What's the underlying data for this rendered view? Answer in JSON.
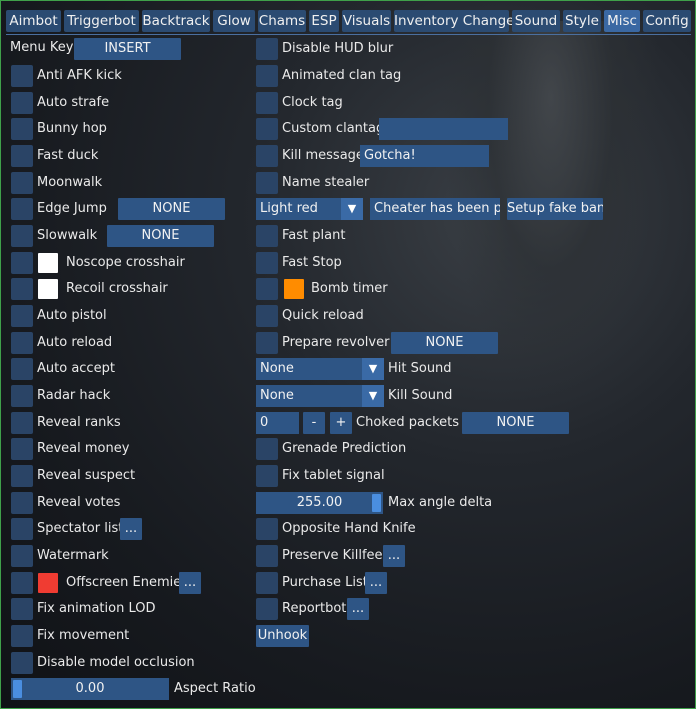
{
  "tabs": [
    "Aimbot",
    "Triggerbot",
    "Backtrack",
    "Glow",
    "Chams",
    "ESP",
    "Visuals",
    "Inventory Changer",
    "Sound",
    "Style",
    "Misc",
    "Config"
  ],
  "active_tab": "Misc",
  "left": {
    "menu_key_label": "Menu Key",
    "menu_key_value": "INSERT",
    "anti_afk": "Anti AFK kick",
    "auto_strafe": "Auto strafe",
    "bunny_hop": "Bunny hop",
    "fast_duck": "Fast duck",
    "moonwalk": "Moonwalk",
    "edge_jump": "Edge Jump",
    "edge_jump_key": "NONE",
    "slowwalk": "Slowwalk",
    "slowwalk_key": "NONE",
    "noscope_crosshair": "Noscope crosshair",
    "recoil_crosshair": "Recoil crosshair",
    "auto_pistol": "Auto pistol",
    "auto_reload": "Auto reload",
    "auto_accept": "Auto accept",
    "radar_hack": "Radar hack",
    "reveal_ranks": "Reveal ranks",
    "reveal_money": "Reveal money",
    "reveal_suspect": "Reveal suspect",
    "reveal_votes": "Reveal votes",
    "spectator_list": "Spectator list",
    "watermark": "Watermark",
    "offscreen_enemies": "Offscreen Enemies",
    "fix_animation_lod": "Fix animation LOD",
    "fix_movement": "Fix movement",
    "disable_model_occlusion": "Disable model occlusion",
    "aspect_ratio_value": "0.00",
    "aspect_ratio_label": "Aspect Ratio",
    "aspect_ratio_fraction": 0.0,
    "dots": "..."
  },
  "right": {
    "disable_hud_blur": "Disable HUD blur",
    "animated_clan_tag": "Animated clan tag",
    "clock_tag": "Clock tag",
    "custom_clantag": "Custom clantag",
    "custom_clantag_value": "",
    "kill_message": "Kill message",
    "kill_message_value": "Gotcha!",
    "name_stealer": "Name stealer",
    "ban_color": "Light red",
    "ban_text": "Cheater has been perr",
    "setup_fake_ban": "Setup fake ban",
    "fast_plant": "Fast plant",
    "fast_stop": "Fast Stop",
    "bomb_timer": "Bomb timer",
    "quick_reload": "Quick reload",
    "prepare_revolver": "Prepare revolver",
    "prepare_revolver_key": "NONE",
    "hit_sound_value": "None",
    "hit_sound_label": "Hit Sound",
    "kill_sound_value": "None",
    "kill_sound_label": "Kill Sound",
    "choked_value": "0",
    "minus": "-",
    "plus": "+",
    "choked_label": "Choked packets",
    "choked_key": "NONE",
    "grenade_prediction": "Grenade Prediction",
    "fix_tablet_signal": "Fix tablet signal",
    "max_angle_value": "255.00",
    "max_angle_label": "Max angle delta",
    "max_angle_fraction": 1.0,
    "opposite_hand_knife": "Opposite Hand Knife",
    "preserve_killfeed": "Preserve Killfeed",
    "purchase_list": "Purchase List",
    "reportbot": "Reportbot",
    "unhook": "Unhook",
    "dots": "..."
  },
  "colors": {
    "noscope_crosshair": "#ffffff",
    "recoil_crosshair": "#ffffff",
    "offscreen_enemies": "#f03c32",
    "bomb_timer": "#ff8c00",
    "frame_border": "#3fa04a"
  },
  "icons": {
    "combo_arrow": "triangle-down-icon"
  }
}
